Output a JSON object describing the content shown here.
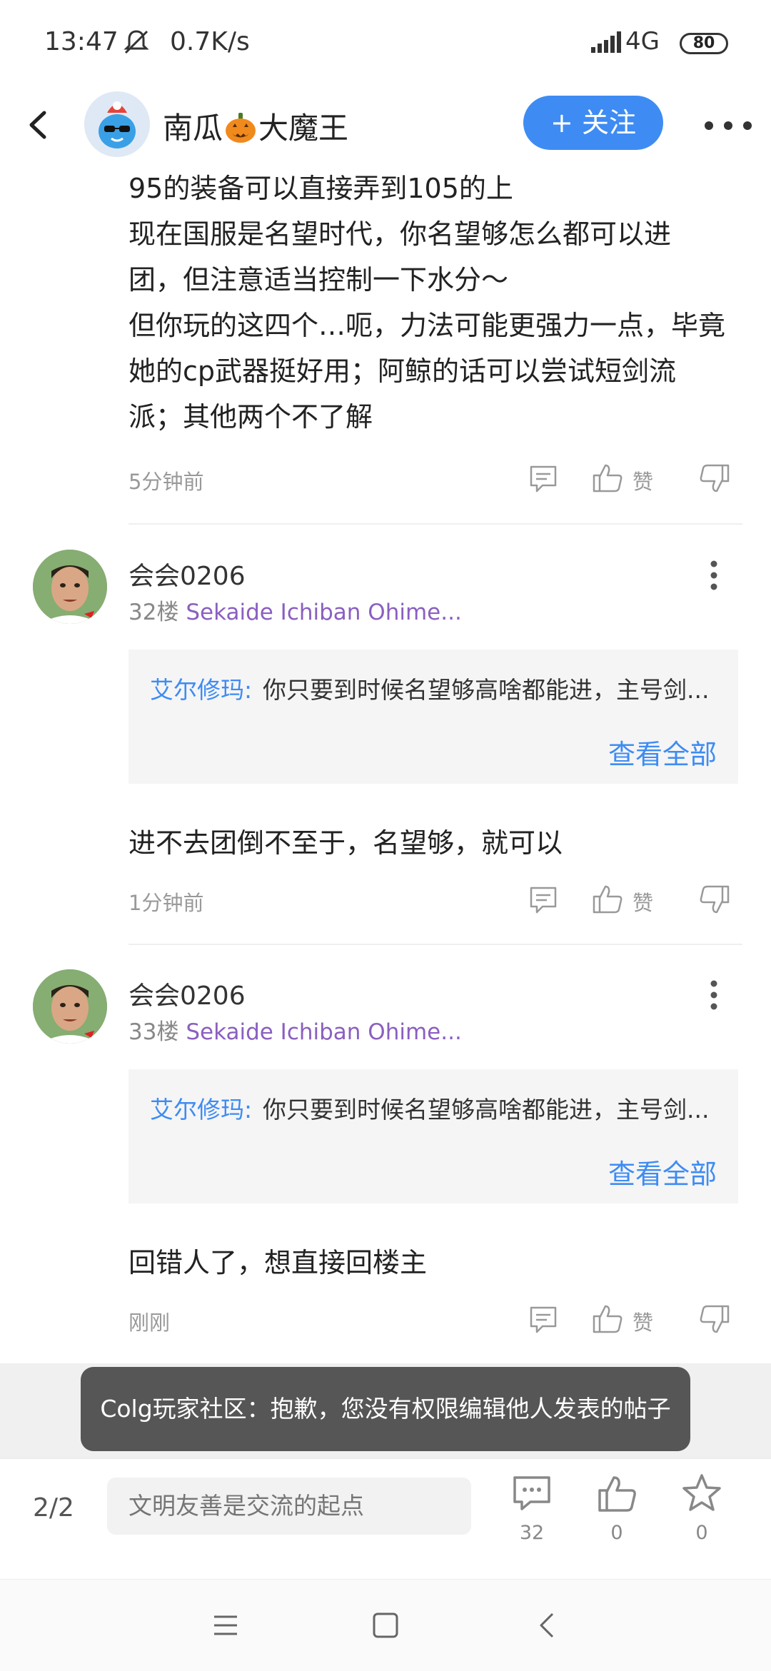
{
  "status_bar": {
    "time": "13:47",
    "net_speed": "0.7K/s",
    "network": "4G",
    "battery": "80"
  },
  "header": {
    "author_name_part1": "南瓜",
    "author_name_part2": "大魔王",
    "follow_label": "+ 关注"
  },
  "post": {
    "lines": [
      "95的装备可以直接弄到105的上",
      "现在国服是名望时代，你名望够怎么都可以进",
      "团，但注意适当控制一下水分～",
      "但你玩的这四个…呃，力法可能更强力一点，毕竟",
      "她的cp武器挺好用；阿鲸的话可以尝试短剑流",
      "派；其他两个不了解"
    ],
    "time": "5分钟前",
    "like_label": "赞"
  },
  "replies": [
    {
      "name": "会会0206",
      "floor": "32楼",
      "target": "Sekaide Ichiban Ohime...",
      "quote_author": "艾尔修玛:",
      "quote_text": "你只要到时候名望够高啥都能进，主号剑...",
      "view_all": "查看全部",
      "text": "进不去团倒不至于，名望够，就可以",
      "time": "1分钟前",
      "like_label": "赞"
    },
    {
      "name": "会会0206",
      "floor": "33楼",
      "target": "Sekaide Ichiban Ohime...",
      "quote_author": "艾尔修玛:",
      "quote_text": "你只要到时候名望够高啥都能进，主号剑...",
      "view_all": "查看全部",
      "text": "回错人了，想直接回楼主",
      "time": "刚刚",
      "like_label": "赞"
    }
  ],
  "toast": "Colg玩家社区：抱歉，您没有权限编辑他人发表的帖子",
  "bottom_bar": {
    "page": "2/2",
    "input_placeholder": "文明友善是交流的起点",
    "comment_count": "32",
    "like_count": "0",
    "favorite_count": "0"
  },
  "colors": {
    "accent": "#3e8cf3",
    "reply_target": "#8a5fc0",
    "toast_bg": "#565656"
  },
  "icons": [
    "back-icon",
    "pumpkin-icon",
    "more-icon",
    "comment-icon",
    "like-icon",
    "dislike-icon",
    "star-icon",
    "menu-icon",
    "home-icon",
    "nav-back-icon"
  ]
}
